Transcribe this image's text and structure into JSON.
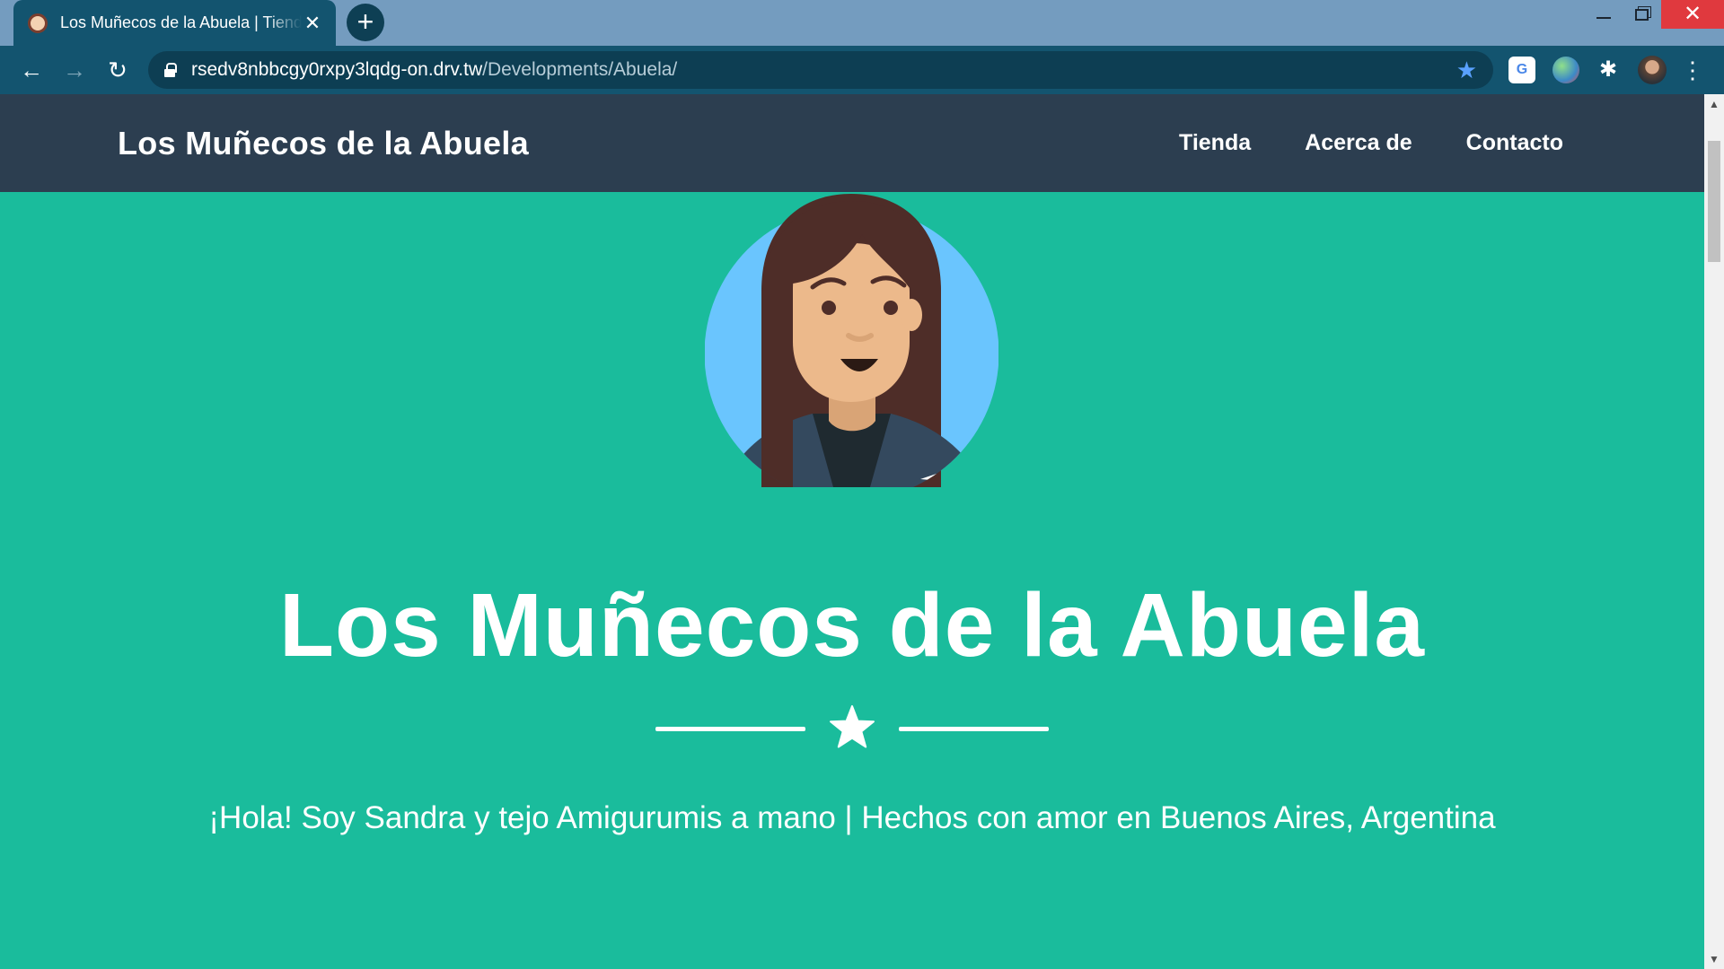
{
  "browser": {
    "tab": {
      "title": "Los Muñecos de la Abuela | Tienda",
      "close_glyph": "✕"
    },
    "new_tab_glyph": "+",
    "window": {
      "close_glyph": "✕"
    },
    "toolbar": {
      "back_glyph": "←",
      "forward_glyph": "→",
      "reload_glyph": "↻",
      "url_host": "rsedv8nbbcgy0rxpy3lqdg-on.drv.tw",
      "url_path": "/Developments/Abuela/",
      "bookmark_glyph": "★",
      "translate_label": "G",
      "extensions_glyph": "✱",
      "menu_glyph": "⋮"
    }
  },
  "site": {
    "brand": "Los Muñecos de la Abuela",
    "nav": [
      "Tienda",
      "Acerca de",
      "Contacto"
    ]
  },
  "hero": {
    "title": "Los Muñecos de la Abuela",
    "tagline": "¡Hola! Soy Sandra y tejo Amigurumis a mano | Hechos con amor en Buenos Aires, Argentina",
    "avatar_icon": "woman-avatar-icon",
    "divider_icon": "star-icon"
  },
  "colors": {
    "hero_bg": "#1abc9c",
    "navbar_bg": "#2c3e50",
    "browser_toolbar": "#13546f",
    "avatar_circle": "#6ac5fe",
    "hair": "#4e2d28",
    "skin": "#ecb98b"
  },
  "scrollbar": {
    "up_glyph": "▲",
    "down_glyph": "▼"
  }
}
